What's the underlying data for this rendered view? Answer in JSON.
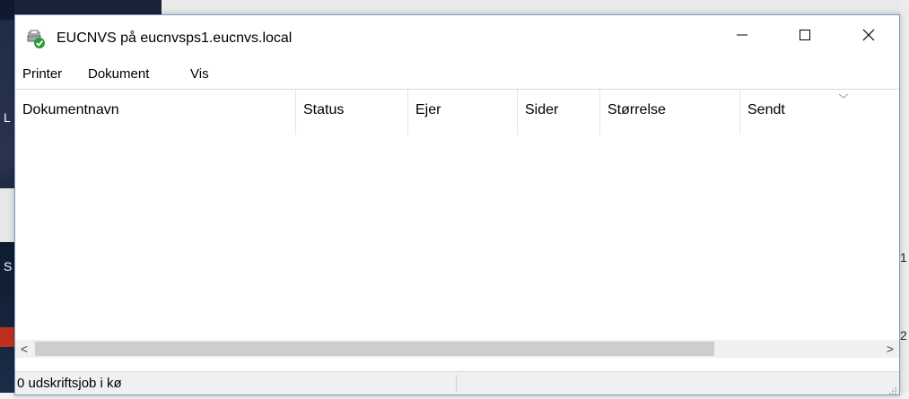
{
  "window": {
    "title": "EUCNVS på eucnvsps1.eucnvs.local",
    "icon": "printer-check-icon"
  },
  "title_buttons": {
    "minimize_icon": "minimize-icon",
    "maximize_icon": "maximize-icon",
    "close_icon": "close-icon"
  },
  "menu": [
    "Printer",
    "Dokument",
    "Vis"
  ],
  "columns": [
    "Dokumentnavn",
    "Status",
    "Ejer",
    "Sider",
    "Størrelse",
    "Sendt"
  ],
  "scrollbar": {
    "left_arrow": "<",
    "right_arrow": ">"
  },
  "status": {
    "text": "0 udskriftsjob i kø"
  },
  "background": {
    "right_letters": [
      "1",
      "2"
    ],
    "left_letters": [
      "L",
      "S"
    ]
  }
}
